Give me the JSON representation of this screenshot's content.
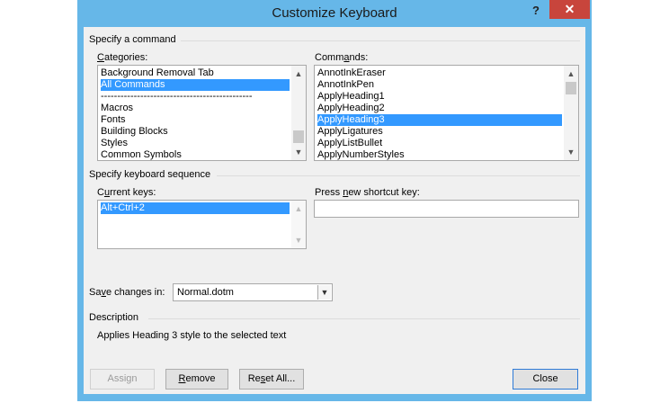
{
  "window": {
    "title": "Customize Keyboard",
    "help_label": "?",
    "close_label": "✕"
  },
  "command_group": {
    "title": "Specify a command"
  },
  "categories": {
    "label_prefix": "",
    "label_accel": "C",
    "label_rest": "ategories:",
    "items": [
      "Background Removal Tab",
      "All Commands",
      "----------------------------------------------",
      "Macros",
      "Fonts",
      "Building Blocks",
      "Styles",
      "Common Symbols"
    ],
    "selected_index": 1
  },
  "commands": {
    "label_prefix": "Comm",
    "label_accel": "a",
    "label_rest": "nds:",
    "items": [
      "AnnotInkEraser",
      "AnnotInkPen",
      "ApplyHeading1",
      "ApplyHeading2",
      "ApplyHeading3",
      "ApplyLigatures",
      "ApplyListBullet",
      "ApplyNumberStyles"
    ],
    "selected_index": 4
  },
  "keyboard_group": {
    "title": "Specify keyboard sequence"
  },
  "current_keys": {
    "label_prefix": "C",
    "label_accel": "u",
    "label_rest": "rrent keys:",
    "items": [
      "Alt+Ctrl+2"
    ],
    "selected_index": 0
  },
  "new_shortcut": {
    "label_prefix": "Press ",
    "label_accel": "n",
    "label_rest": "ew shortcut key:",
    "value": ""
  },
  "save_changes": {
    "label_prefix": "Sa",
    "label_accel": "v",
    "label_rest": "e changes in:",
    "value": "Normal.dotm"
  },
  "description": {
    "title": "Description",
    "text": "Applies Heading 3 style to the selected text"
  },
  "buttons": {
    "assign": "Assign",
    "remove_accel": "R",
    "remove_rest": "emove",
    "reset_prefix": "Re",
    "reset_accel": "s",
    "reset_rest": "et All...",
    "close": "Close"
  }
}
